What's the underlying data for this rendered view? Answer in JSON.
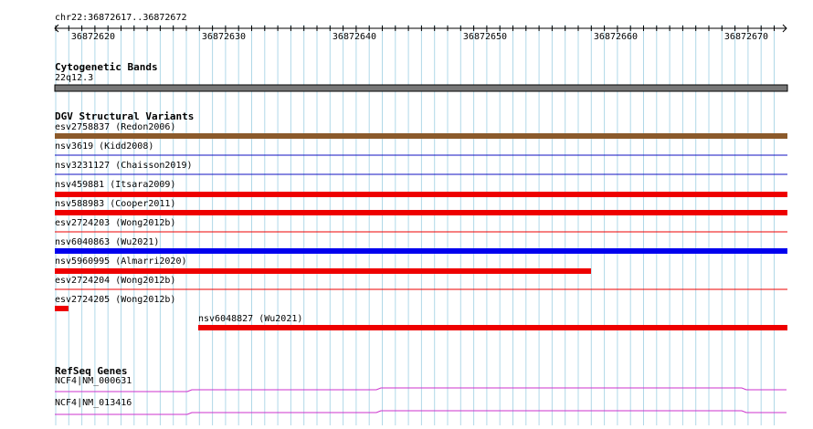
{
  "ruler": {
    "region": "chr22:36872617..36872672",
    "ticks": [
      "36872620",
      "36872630",
      "36872640",
      "36872650",
      "36872660",
      "36872670"
    ]
  },
  "cytoband": {
    "title": "Cytogenetic Bands",
    "band": "22q12.3",
    "color": "#777777"
  },
  "dgv": {
    "title": "DGV Structural Variants",
    "items": [
      {
        "label": "esv2758837 (Redon2006)",
        "color": "#8B5A2B"
      },
      {
        "label": "nsv3619 (Kidd2008)",
        "color": "#1010c0"
      },
      {
        "label": "nsv3231127 (Chaisson2019)",
        "color": "#1010c0"
      },
      {
        "label": "nsv459881 (Itsara2009)",
        "color": "#ee0000"
      },
      {
        "label": "nsv588983 (Cooper2011)",
        "color": "#ee0000"
      },
      {
        "label": "esv2724203 (Wong2012b)",
        "color": "#ee0000"
      },
      {
        "label": "nsv6040863 (Wu2021)",
        "color": "#0000ee"
      },
      {
        "label": "nsv5960995 (Almarri2020)",
        "color": "#ee0000"
      },
      {
        "label": "esv2724204 (Wong2012b)",
        "color": "#ee0000"
      },
      {
        "label": "esv2724205 (Wong2012b)",
        "color": "#ee0000"
      },
      {
        "label": "nsv6048827 (Wu2021)",
        "color": "#ee0000"
      }
    ]
  },
  "refseq": {
    "title": "RefSeq Genes",
    "items": [
      {
        "label": "NCF4|NM_000631",
        "color": "#cc33cc"
      },
      {
        "label": "NCF4|NM_013416",
        "color": "#cc33cc"
      }
    ]
  },
  "colors": {
    "grid": "#b0d8e8",
    "ruler": "#000000"
  }
}
